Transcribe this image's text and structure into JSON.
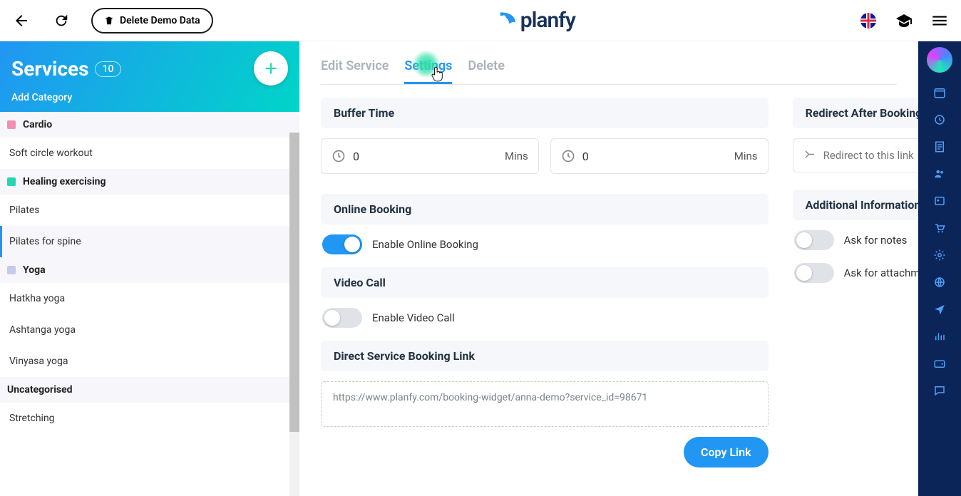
{
  "header": {
    "delete_demo_label": "Delete Demo Data",
    "brand": "planfy"
  },
  "sidebar": {
    "title": "Services",
    "count": "10",
    "add_category_label": "Add Category",
    "groups": [
      {
        "name": "Cardio",
        "swatch": "#f48fb1",
        "items": [
          {
            "label": "Soft circle workout"
          }
        ]
      },
      {
        "name": "Healing exercising",
        "swatch": "#26d7ae",
        "items": [
          {
            "label": "Pilates"
          },
          {
            "label": "Pilates for spine",
            "selected": true,
            "highlighted": true
          }
        ]
      },
      {
        "name": "Yoga",
        "swatch": "#c5cae9",
        "items": [
          {
            "label": "Hatkha yoga"
          },
          {
            "label": "Ashtanga yoga"
          },
          {
            "label": "Vinyasa yoga"
          }
        ]
      },
      {
        "name": "Uncategorised",
        "swatch": "",
        "items": [
          {
            "label": "Stretching"
          }
        ]
      }
    ]
  },
  "tabs": {
    "edit": "Edit Service",
    "settings": "Settings",
    "delete": "Delete"
  },
  "left_col": {
    "buffer_header": "Buffer Time",
    "buffer_before": "0",
    "buffer_after": "0",
    "mins_suffix": "Mins",
    "online_header": "Online Booking",
    "online_toggle_label": "Enable Online Booking",
    "video_header": "Video Call",
    "video_toggle_label": "Enable Video Call",
    "link_header": "Direct Service Booking Link",
    "link_value": "https://www.planfy.com/booking-widget/anna-demo?service_id=98671",
    "copy_label": "Copy Link"
  },
  "right_col": {
    "redirect_header": "Redirect After Booking",
    "redirect_placeholder": "Redirect to this link",
    "addl_header": "Additional Information",
    "ask_notes_label": "Ask for notes",
    "ask_attach_label": "Ask for attachments"
  }
}
